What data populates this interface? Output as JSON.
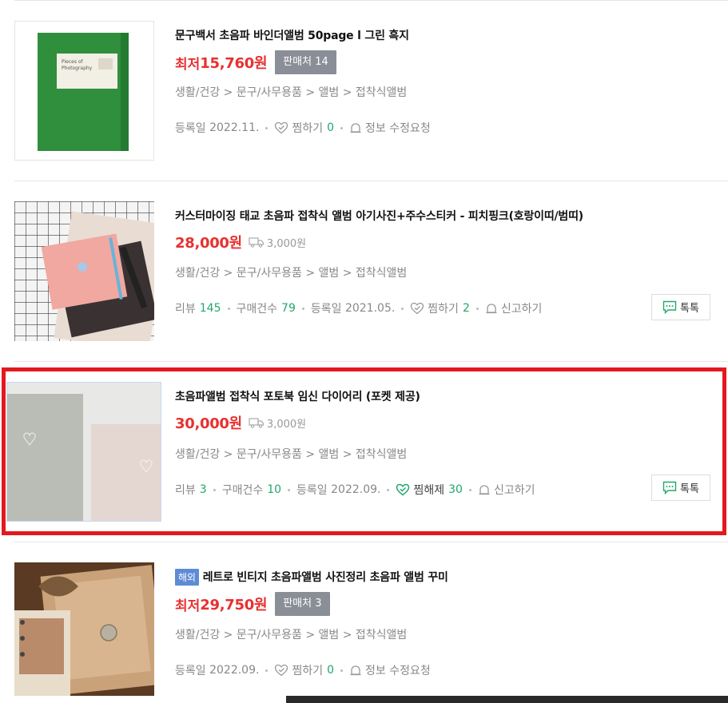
{
  "items": [
    {
      "title": "문구백서 초음파 바인더앨범 50page l 그린 흑지",
      "price_label": "최저",
      "price": "15,760원",
      "seller_badge": "판매처 14",
      "category": "생활/건강 > 문구/사무용품 > 앨범 > 접착식앨범",
      "reg_label": "등록일",
      "reg_date": "2022.11.",
      "wish_label": "찜하기",
      "wish_count": "0",
      "report_label": "정보 수정요청",
      "thumb_text_1": "Pieces of",
      "thumb_text_2": "Photography"
    },
    {
      "title": "커스터마이징 태교 초음파 접착식 앨범 아기사진+주수스티커 - 피치핑크(호랑이띠/범띠)",
      "price": "28,000원",
      "shipping": "3,000원",
      "category": "생활/건강 > 문구/사무용품 > 앨범 > 접착식앨범",
      "review_label": "리뷰",
      "review_count": "145",
      "purchase_label": "구매건수",
      "purchase_count": "79",
      "reg_label": "등록일",
      "reg_date": "2021.05.",
      "wish_label": "찜하기",
      "wish_count": "2",
      "report_label": "신고하기",
      "talk_label": "톡톡"
    },
    {
      "title": "초음파앨범 접착식 포토북 임신 다이어리 (포켓 제공)",
      "price": "30,000원",
      "shipping": "3,000원",
      "category": "생활/건강 > 문구/사무용품 > 앨범 > 접착식앨범",
      "review_label": "리뷰",
      "review_count": "3",
      "purchase_label": "구매건수",
      "purchase_count": "10",
      "reg_label": "등록일",
      "reg_date": "2022.09.",
      "wish_label": "찜해제",
      "wish_count": "30",
      "report_label": "신고하기",
      "talk_label": "톡톡"
    },
    {
      "badge": "해외",
      "title": "레트로 빈티지 초음파앨범 사진정리 초음파 앨범 꾸미",
      "price_label": "최저",
      "price": "29,750원",
      "seller_badge": "판매처 3",
      "category": "생활/건강 > 문구/사무용품 > 앨범 > 접착식앨범",
      "reg_label": "등록일",
      "reg_date": "2022.09.",
      "wish_label": "찜하기",
      "wish_count": "0",
      "report_label": "정보 수정요청"
    }
  ],
  "colors": {
    "price": "#e8312f",
    "count": "#22a86b",
    "highlight": "#e3191f",
    "seller_badge": "#8a8e96",
    "overseas_badge": "#5f8bd6"
  }
}
